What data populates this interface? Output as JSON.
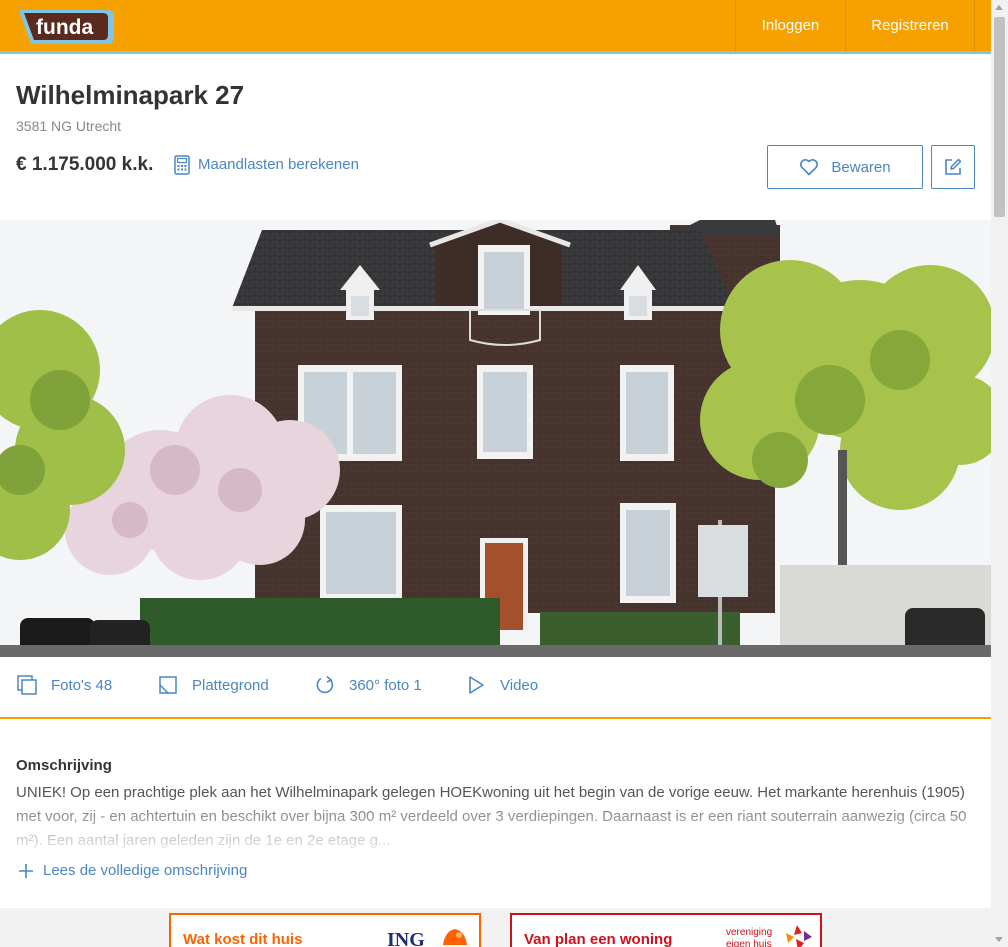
{
  "header": {
    "logo_text": "funda",
    "login_label": "Inloggen",
    "register_label": "Registreren"
  },
  "listing": {
    "title": "Wilhelminapark 27",
    "address": "3581 NG Utrecht",
    "price": "€ 1.175.000 k.k.",
    "calc_label": "Maandlasten berekenen",
    "save_label": "Bewaren"
  },
  "media": {
    "photos_label": "Foto's 48",
    "floorplan_label": "Plattegrond",
    "photo360_label": "360° foto 1",
    "video_label": "Video"
  },
  "description": {
    "heading": "Omschrijving",
    "text": "UNIEK! Op een prachtige plek aan het Wilhelminapark gelegen HOEKwoning uit het begin van de vorige eeuw. Het markante herenhuis (1905) met voor, zij - en achtertuin en beschikt over bijna 300 m² verdeeld over 3 verdiepingen. Daarnaast is er een riant souterrain aanwezig (circa 50 m²). Een aantal jaren geleden zijn de 1e en 2e etage g...",
    "more_label": "Lees de volledige omschrijving"
  },
  "ads": {
    "ing_text": "Wat kost dit huis",
    "ing_brand": "ING",
    "vei_text": "Van plan een woning",
    "vei_brand_line1": "vereniging",
    "vei_brand_line2": "eigen huis"
  },
  "colors": {
    "brand_orange": "#f7a100",
    "link_blue": "#4a86c5",
    "header_accent": "#7fc5e6"
  }
}
